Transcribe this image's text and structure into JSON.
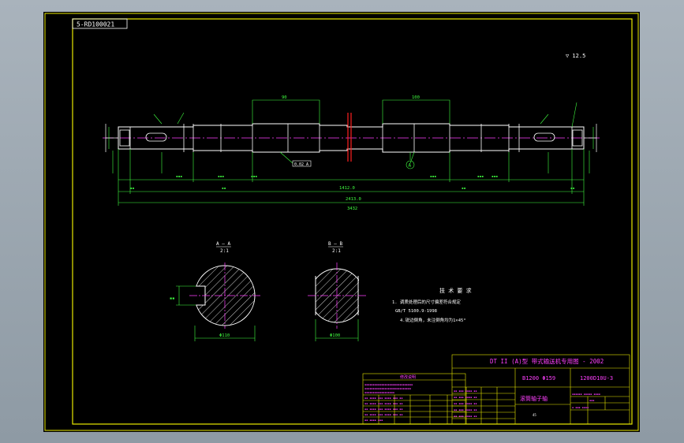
{
  "drawing": {
    "code_box": "5-RD100021",
    "surface_note": "▽ 12.5"
  },
  "dimensions": {
    "overall_length": "3432",
    "span_1": "1412.0",
    "span_2": "2413.0",
    "hub_left": "90",
    "hub_right": "100",
    "tolerance_frame": "0.02 A",
    "datum": "A"
  },
  "sections": {
    "a_label": "A — A",
    "a_scale": "2:1",
    "b_label": "B — B",
    "b_scale": "2:1",
    "a_width": "Φ110",
    "b_width": "Φ100"
  },
  "tech_notes": {
    "title": "技 术 要 求",
    "line1": "1. 调质处理后的尺寸偏差符合规定",
    "line2": "GB/T 5100.9-1998",
    "line3": "4.锐边倒角，未注倒角均为1×45°"
  },
  "title_block": {
    "header": "DT II (A)型  带式输送机专用图 - 2002",
    "spec_left": "B1200  Φ159",
    "drawing_no": "1200D10U-3",
    "part_name": "滚筒轴子轴",
    "material": "45"
  },
  "revision_table": {
    "title": "修改说明"
  },
  "colors": {
    "frame": "#e8e800",
    "outline": "#ffffff",
    "dimension": "#40ff40",
    "centerline": "#ff40ff",
    "hatch": "#ffffff",
    "cut_line": "#ff2020"
  }
}
